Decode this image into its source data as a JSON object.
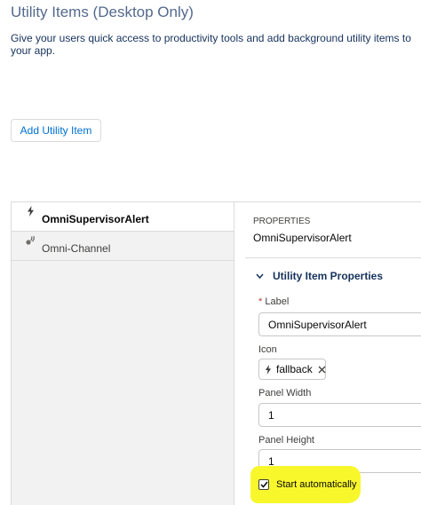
{
  "page": {
    "title": "Utility Items (Desktop Only)",
    "subtitle": "Give your users quick access to productivity tools and add background utility items to your app."
  },
  "toolbar": {
    "add_label": "Add Utility Item"
  },
  "sidebar": {
    "items": [
      {
        "label": "OmniSupervisorAlert",
        "icon": "lightning-icon",
        "active": true
      },
      {
        "label": "Omni-Channel",
        "icon": "omni-channel-icon",
        "active": false
      }
    ]
  },
  "properties": {
    "heading": "PROPERTIES",
    "item_name": "OmniSupervisorAlert",
    "section_title": "Utility Item Properties",
    "label_field": {
      "required_mark": "*",
      "label": "Label",
      "value": "OmniSupervisorAlert"
    },
    "icon_field": {
      "label": "Icon",
      "value": "fallback",
      "icon": "lightning-icon"
    },
    "panel_width": {
      "label": "Panel Width",
      "value": "1"
    },
    "panel_height": {
      "label": "Panel Height",
      "value": "1"
    },
    "start_automatically": {
      "label": "Start automatically",
      "checked": true
    }
  },
  "colors": {
    "link": "#0070d2",
    "highlight": "#f8f72c",
    "sidebar_bg": "#f3f2f2"
  }
}
